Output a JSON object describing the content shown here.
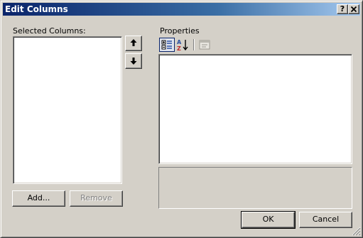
{
  "window": {
    "title": "Edit Columns",
    "help_label": "?",
    "close_label": "x"
  },
  "left_panel": {
    "selected_columns_label": "Selected Columns:",
    "columns": [],
    "add_label": "Add...",
    "remove_label": "Remove"
  },
  "right_panel": {
    "properties_label": "Properties"
  },
  "footer": {
    "ok_label": "OK",
    "cancel_label": "Cancel"
  },
  "icons": {
    "move_up": "arrow-up-icon",
    "move_down": "arrow-down-icon",
    "categorized": "categorized-icon",
    "alphabetical": "alphabetical-sort-icon",
    "property_pages": "property-pages-icon",
    "resize_grip": "resize-grip-icon"
  },
  "colors": {
    "title_bar_start": "#0a246a",
    "title_bar_end": "#a6caf0",
    "face": "#d4d0c8",
    "window_bg": "#ffffff"
  }
}
